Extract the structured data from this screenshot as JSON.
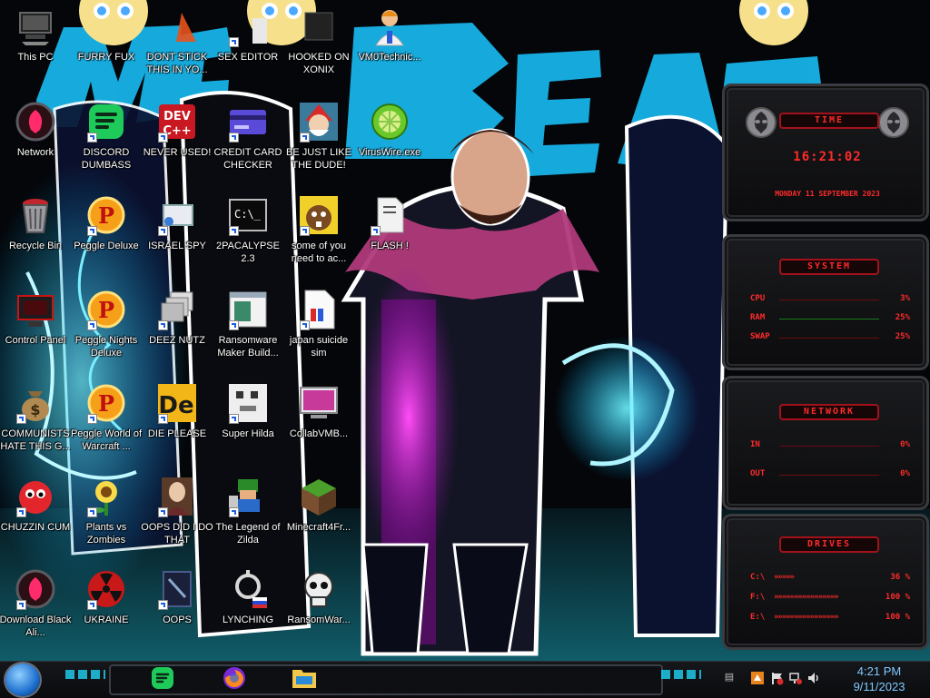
{
  "desktop": {
    "icons": [
      {
        "label": "This PC"
      },
      {
        "label": "FURRY FUX"
      },
      {
        "label": "DONT STICK THIS IN YO..."
      },
      {
        "label": "SEX EDITOR"
      },
      {
        "label": "HOOKED ON XONIX"
      },
      {
        "label": "VM0Technic..."
      },
      {
        "label": "Network"
      },
      {
        "label": "DISCORD DUMBASS"
      },
      {
        "label": "NEVER USED!"
      },
      {
        "label": "CREDIT CARD CHECKER"
      },
      {
        "label": "BE JUST LIKE THE DUDE!"
      },
      {
        "label": "VirusWire.exe"
      },
      {
        "label": "Recycle Bin"
      },
      {
        "label": "Peggle Deluxe"
      },
      {
        "label": "ISRAEL SPY"
      },
      {
        "label": "2PACALYPSE 2.3"
      },
      {
        "label": "some of you need to ac..."
      },
      {
        "label": "FLASH !"
      },
      {
        "label": "Control Panel"
      },
      {
        "label": "Peggle Nights Deluxe"
      },
      {
        "label": "DEEZ NUTZ"
      },
      {
        "label": "Ransomware Maker Build..."
      },
      {
        "label": "japan suicide sim"
      },
      {
        "label": "COMMUNISTS HATE THIS G..."
      },
      {
        "label": "Peggle World of Warcraft ..."
      },
      {
        "label": "DIE PLEASE"
      },
      {
        "label": "Super Hilda"
      },
      {
        "label": "CollabVMB..."
      },
      {
        "label": "CHUZZIN CUM"
      },
      {
        "label": "Plants vs Zombies"
      },
      {
        "label": "OOPS DID I DO THAT"
      },
      {
        "label": "The Legend of Zilda"
      },
      {
        "label": "Minecraft4Fr..."
      },
      {
        "label": "Download Black Ali..."
      },
      {
        "label": "UKRAINE"
      },
      {
        "label": "OOPS"
      },
      {
        "label": "LYNCHING"
      },
      {
        "label": "RansomWar..."
      }
    ]
  },
  "widgets": {
    "time": {
      "title": "TIME",
      "clock": "16:21:02",
      "date": "MONDAY 11 SEPTEMBER 2023"
    },
    "system": {
      "title": "SYSTEM",
      "rows": [
        {
          "key": "CPU",
          "value": "3%"
        },
        {
          "key": "RAM",
          "value": "25%"
        },
        {
          "key": "SWAP",
          "value": "25%"
        }
      ]
    },
    "network": {
      "title": "NETWORK",
      "rows": [
        {
          "key": "IN",
          "value": "0%"
        },
        {
          "key": "OUT",
          "value": "0%"
        }
      ]
    },
    "drives": {
      "title": "DRIVES",
      "rows": [
        {
          "key": "C:\\",
          "value": "36 %"
        },
        {
          "key": "F:\\",
          "value": "100 %"
        },
        {
          "key": "E:\\",
          "value": "100 %"
        }
      ]
    }
  },
  "taskbar": {
    "clock_time": "4:21 PM",
    "clock_date": "9/11/2023",
    "pinned": [
      {
        "name": "discord-chat"
      },
      {
        "name": "firefox"
      },
      {
        "name": "file-explorer"
      }
    ]
  },
  "colors": {
    "accent_red": "#ff2b2b",
    "wallpaper_cyan": "#18b3e8",
    "taskbar_cyan": "#1ec9e8"
  }
}
